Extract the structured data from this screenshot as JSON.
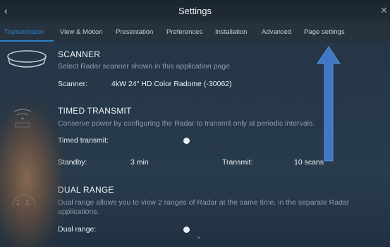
{
  "header": {
    "title": "Settings",
    "back_icon": "chevron-left-icon",
    "close_icon": "close-icon"
  },
  "tabs": [
    {
      "label": "Transmission",
      "active": true
    },
    {
      "label": "View & Motion"
    },
    {
      "label": "Presentation"
    },
    {
      "label": "Preferences"
    },
    {
      "label": "Installation"
    },
    {
      "label": "Advanced"
    },
    {
      "label": "Page settings"
    }
  ],
  "scanner": {
    "title": "SCANNER",
    "description": "Select Radar scanner shown in this application page",
    "label": "Scanner:",
    "value": "4kW 24\" HD Color Radome (-30062)"
  },
  "timed_transmit": {
    "title": "TIMED TRANSMIT",
    "description": "Conserve power by configuring the Radar to transmit only at periodic intervals.",
    "toggle_label": "Timed transmit:",
    "standby_label": "Standby:",
    "standby_value": "3 min",
    "transmit_label": "Transmit:",
    "transmit_value": "10 scans"
  },
  "dual_range": {
    "title": "DUAL RANGE",
    "description_line1": "Dual range allows you to view 2 ranges of Radar at the same time, in the separate Radar",
    "description_line2": "applications.",
    "toggle_label": "Dual range:",
    "icon_labels": [
      "1",
      "2"
    ]
  },
  "colors": {
    "accent": "#2d83c8",
    "arrow": "#3f78c4"
  }
}
